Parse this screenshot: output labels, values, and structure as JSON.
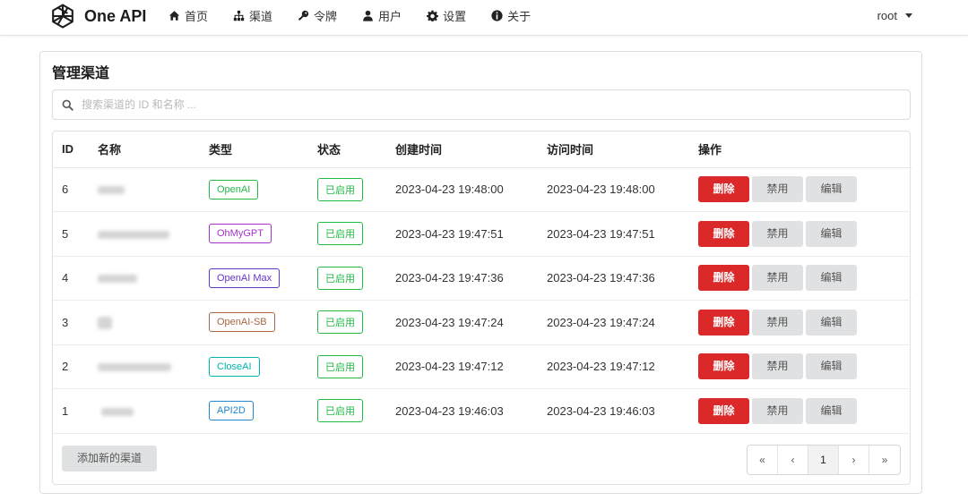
{
  "brand": {
    "name": "One API"
  },
  "nav": [
    {
      "label": "首页",
      "icon": "home-icon"
    },
    {
      "label": "渠道",
      "icon": "sitemap-icon"
    },
    {
      "label": "令牌",
      "icon": "key-icon"
    },
    {
      "label": "用户",
      "icon": "user-icon"
    },
    {
      "label": "设置",
      "icon": "gear-icon"
    },
    {
      "label": "关于",
      "icon": "info-icon"
    }
  ],
  "user_menu": {
    "label": "root"
  },
  "page": {
    "title": "管理渠道",
    "search_placeholder": "搜索渠道的 ID 和名称 ..."
  },
  "table": {
    "columns": [
      "ID",
      "名称",
      "类型",
      "状态",
      "创建时间",
      "访问时间",
      "操作"
    ],
    "rows": [
      {
        "id": "6",
        "type": "OpenAI",
        "type_color": "#21ba45",
        "status": "已启用",
        "created": "2023-04-23 19:48:00",
        "accessed": "2023-04-23 19:48:00"
      },
      {
        "id": "5",
        "type": "OhMyGPT",
        "type_color": "#a333c8",
        "status": "已启用",
        "created": "2023-04-23 19:47:51",
        "accessed": "2023-04-23 19:47:51"
      },
      {
        "id": "4",
        "type": "OpenAI Max",
        "type_color": "#6435c9",
        "status": "已启用",
        "created": "2023-04-23 19:47:36",
        "accessed": "2023-04-23 19:47:36"
      },
      {
        "id": "3",
        "type": "OpenAI-SB",
        "type_color": "#a5673f",
        "status": "已启用",
        "created": "2023-04-23 19:47:24",
        "accessed": "2023-04-23 19:47:24"
      },
      {
        "id": "2",
        "type": "CloseAI",
        "type_color": "#00b5ad",
        "status": "已启用",
        "created": "2023-04-23 19:47:12",
        "accessed": "2023-04-23 19:47:12"
      },
      {
        "id": "1",
        "type": "API2D",
        "type_color": "#2185d0",
        "status": "已启用",
        "created": "2023-04-23 19:46:03",
        "accessed": "2023-04-23 19:46:03"
      }
    ],
    "actions": {
      "delete": "删除",
      "disable": "禁用",
      "edit": "编辑"
    }
  },
  "footer": {
    "add_button": "添加新的渠道",
    "pagination": [
      "«",
      "‹",
      "1",
      "›",
      "»"
    ],
    "current_page": "1"
  },
  "colors": {
    "danger": "#db2828",
    "success": "#21ba45"
  }
}
